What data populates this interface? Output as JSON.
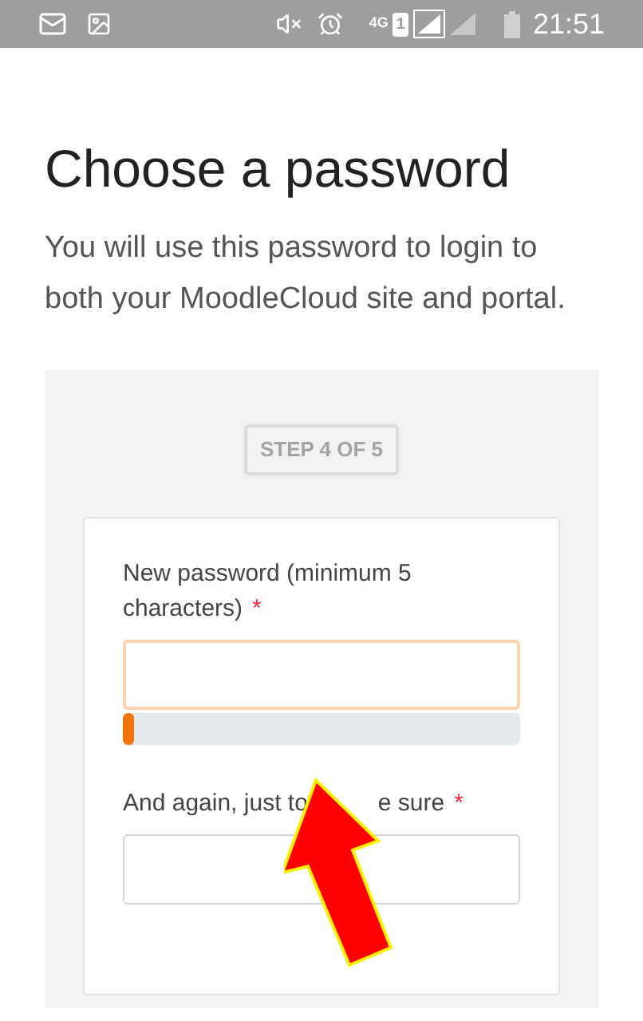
{
  "status_bar": {
    "network": "4G",
    "sim": "1",
    "time": "21:51"
  },
  "heading": "Choose a password",
  "intro": "You will use this password to login to both your MoodleCloud site and portal.",
  "step": "STEP 4 OF 5",
  "fields": [
    {
      "label_parts": [
        "New password (minimum 5 characters)"
      ],
      "required_mark": "*",
      "focused": true,
      "strength": {
        "level": 0.03
      }
    },
    {
      "label_parts": [
        "And again, just to",
        "e sure"
      ],
      "required_mark": "*",
      "focused": false
    }
  ]
}
